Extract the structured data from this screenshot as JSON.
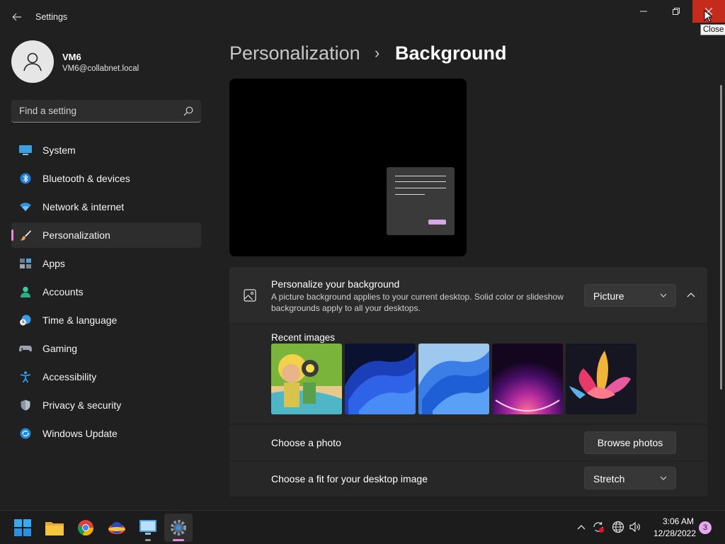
{
  "window": {
    "title": "Settings",
    "close_tooltip": "Close"
  },
  "user": {
    "name": "VM6",
    "email": "VM6@collabnet.local"
  },
  "search": {
    "placeholder": "Find a setting"
  },
  "sidebar": {
    "items": [
      {
        "label": "System",
        "icon": "system-icon"
      },
      {
        "label": "Bluetooth & devices",
        "icon": "bluetooth-icon"
      },
      {
        "label": "Network & internet",
        "icon": "wifi-icon"
      },
      {
        "label": "Personalization",
        "icon": "brush-icon",
        "active": true
      },
      {
        "label": "Apps",
        "icon": "apps-icon"
      },
      {
        "label": "Accounts",
        "icon": "accounts-icon"
      },
      {
        "label": "Time & language",
        "icon": "time-language-icon"
      },
      {
        "label": "Gaming",
        "icon": "gamepad-icon"
      },
      {
        "label": "Accessibility",
        "icon": "accessibility-icon"
      },
      {
        "label": "Privacy & security",
        "icon": "shield-icon"
      },
      {
        "label": "Windows Update",
        "icon": "update-icon"
      }
    ]
  },
  "breadcrumb": {
    "parent": "Personalization",
    "separator": "›",
    "current": "Background"
  },
  "background": {
    "title": "Personalize your background",
    "description": "A picture background applies to your current desktop. Solid color or slideshow backgrounds apply to all your desktops.",
    "type_value": "Picture",
    "recent_images_label": "Recent images",
    "recent_images": [
      "cartoon-character-image",
      "blue-bloom-dark-image",
      "blue-bloom-light-image",
      "purple-glow-image",
      "flower-image"
    ],
    "choose_photo_label": "Choose a photo",
    "browse_button": "Browse photos",
    "fit_label": "Choose a fit for your desktop image",
    "fit_value": "Stretch"
  },
  "taskbar": {
    "apps": [
      "start-icon",
      "file-explorer-icon",
      "chrome-icon",
      "app-icon",
      "remote-desktop-icon",
      "settings-icon"
    ],
    "time": "3:06 AM",
    "date": "12/28/2022",
    "notification_count": "3"
  },
  "colors": {
    "accent": "#e58bde",
    "close_red": "#c42b1c",
    "background": "#202020",
    "card": "#2b2b2b"
  }
}
